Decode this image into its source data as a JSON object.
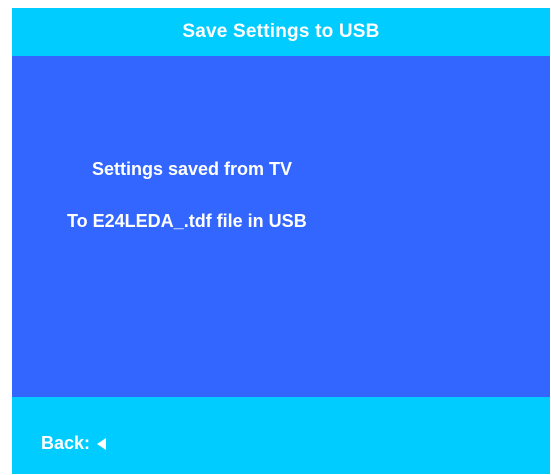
{
  "dialog": {
    "title": "Save Settings to USB",
    "message_line_1": "Settings saved from TV",
    "message_line_2": "To E24LEDA_.tdf file in USB",
    "back_label": "Back:",
    "back_icon": "left-triangle-icon"
  },
  "colors": {
    "bar": "#00CCFF",
    "panel": "#3366FF",
    "text": "#FFFFFF"
  }
}
